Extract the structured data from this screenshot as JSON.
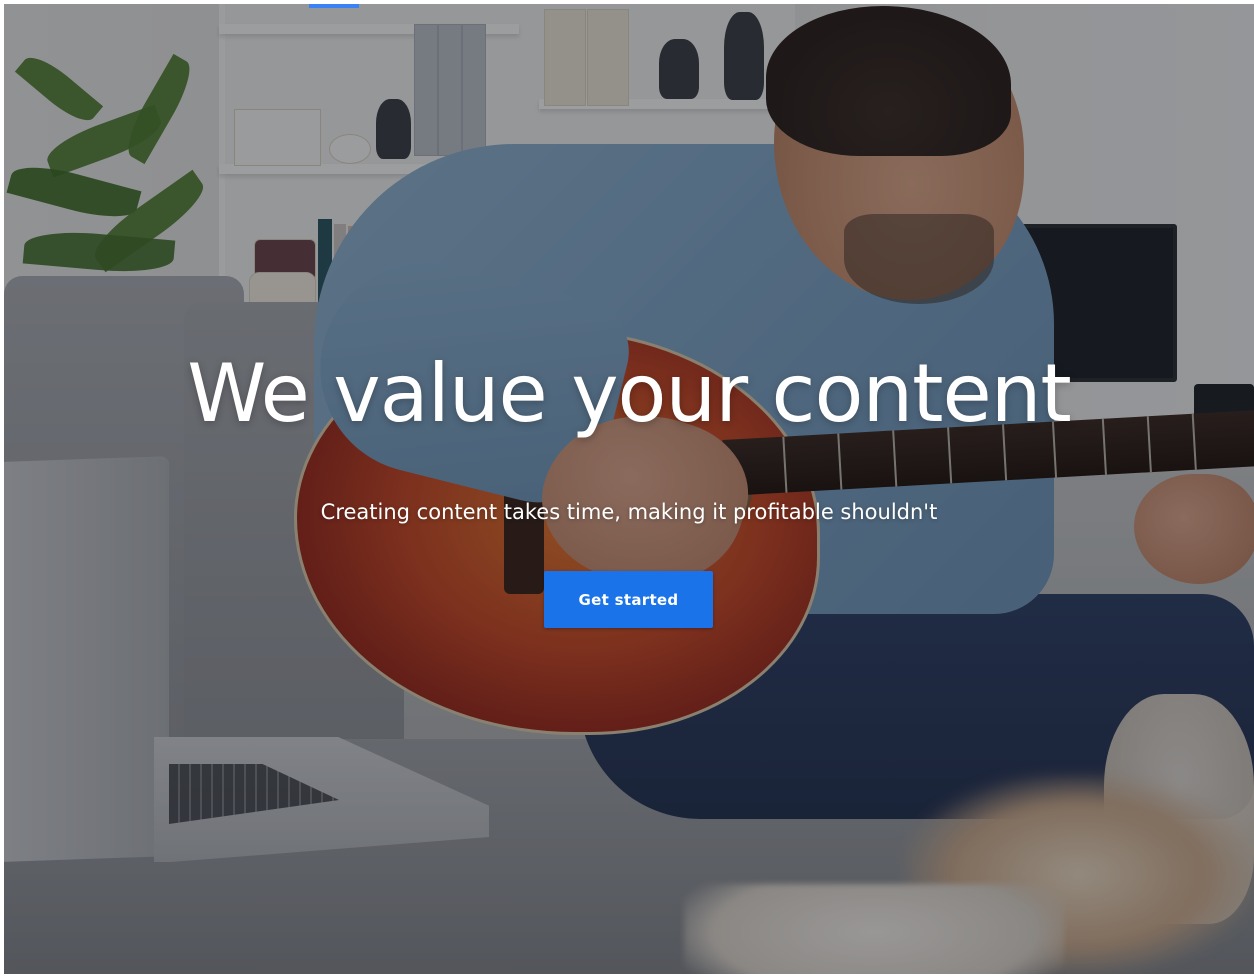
{
  "hero": {
    "title": "We value your content",
    "subtitle": "Creating content takes time, making it profitable shouldn't",
    "cta_label": "Get started"
  },
  "colors": {
    "cta_background": "#1a73e8",
    "cta_text": "#ffffff",
    "title_text": "#ffffff",
    "top_indicator": "#3b82f6"
  }
}
